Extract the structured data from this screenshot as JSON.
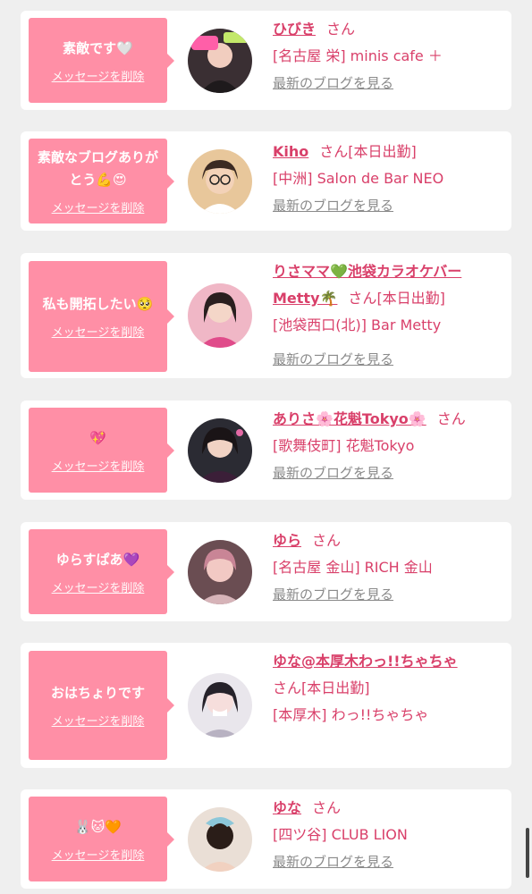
{
  "delete_label": "メッセージを削除",
  "blog_label": "最新のブログを見る",
  "san_label": "さん",
  "accent_color": "#d9406a",
  "bubble_color": "#ff8fa6",
  "items": [
    {
      "message": "素敵です🤍",
      "name": "ひびき",
      "status": "",
      "shop": "[名古屋 栄] minis cafe ＋"
    },
    {
      "message": "素敵なブログありがとう💪😍",
      "name": "Kiho",
      "status": "[本日出勤]",
      "shop": "[中洲] Salon de Bar NEO"
    },
    {
      "message": "私も開拓したい🥺",
      "name": "りさママ💚池袋カラオケバーMetty🌴",
      "status": "[本日出勤]",
      "shop": "[池袋西口(北)] Bar Metty"
    },
    {
      "message": "💖",
      "name": "ありさ🌸花魁Tokyo🌸",
      "status": "",
      "shop": "[歌舞伎町] 花魁Tokyo"
    },
    {
      "message": "ゆらすぱあ💜",
      "name": "ゆら",
      "status": "",
      "shop": "[名古屋 金山] RICH 金山"
    },
    {
      "message": "おはちょりです",
      "name": "ゆな@本厚木わっ!!ちゃちゃ",
      "status": "[本日出勤]",
      "shop": "[本厚木] わっ!!ちゃちゃ"
    },
    {
      "message": "🐰🐱🧡",
      "name": "ゆな",
      "status": "",
      "shop": "[四ツ谷] CLUB LION"
    }
  ]
}
